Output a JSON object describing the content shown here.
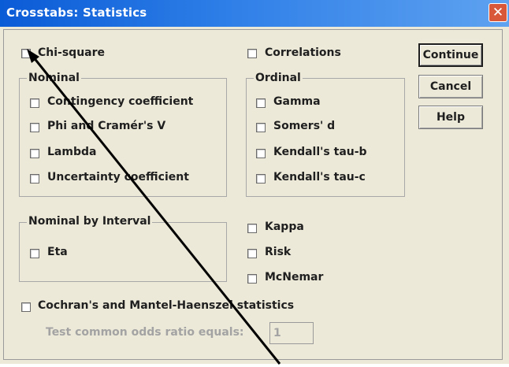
{
  "window": {
    "title": "Crosstabs: Statistics",
    "close_glyph": "✕"
  },
  "chi_square": {
    "label": "Chi-square",
    "checked": false
  },
  "correlations": {
    "label": "Correlations",
    "checked": false
  },
  "nominal": {
    "title": "Nominal",
    "items": [
      {
        "label": "Contingency coefficient",
        "checked": false
      },
      {
        "label": "Phi and Cramér's V",
        "checked": false
      },
      {
        "label": "Lambda",
        "checked": false
      },
      {
        "label": "Uncertainty coefficient",
        "checked": false
      }
    ]
  },
  "ordinal": {
    "title": "Ordinal",
    "items": [
      {
        "label": "Gamma",
        "checked": false
      },
      {
        "label": "Somers' d",
        "checked": false
      },
      {
        "label": "Kendall's tau-b",
        "checked": false
      },
      {
        "label": "Kendall's tau-c",
        "checked": false
      }
    ]
  },
  "nominal_by_interval": {
    "title": "Nominal by Interval",
    "items": [
      {
        "label": "Eta",
        "checked": false
      }
    ]
  },
  "other": {
    "items": [
      {
        "label": "Kappa",
        "checked": false
      },
      {
        "label": "Risk",
        "checked": false
      },
      {
        "label": "McNemar",
        "checked": false
      }
    ]
  },
  "cochran": {
    "label": "Cochran's and Mantel-Haenszel statistics",
    "checked": false
  },
  "odds": {
    "label": "Test common odds ratio equals:",
    "value": "1"
  },
  "buttons": {
    "continue": "Continue",
    "cancel": "Cancel",
    "help": "Help"
  },
  "colors": {
    "titlebar": "#0a5bd6",
    "dialog_bg": "#ece9d8",
    "close": "#d9583a"
  },
  "icons": {
    "close": "close-icon",
    "pointer": "pointer-arrow-annotation"
  }
}
